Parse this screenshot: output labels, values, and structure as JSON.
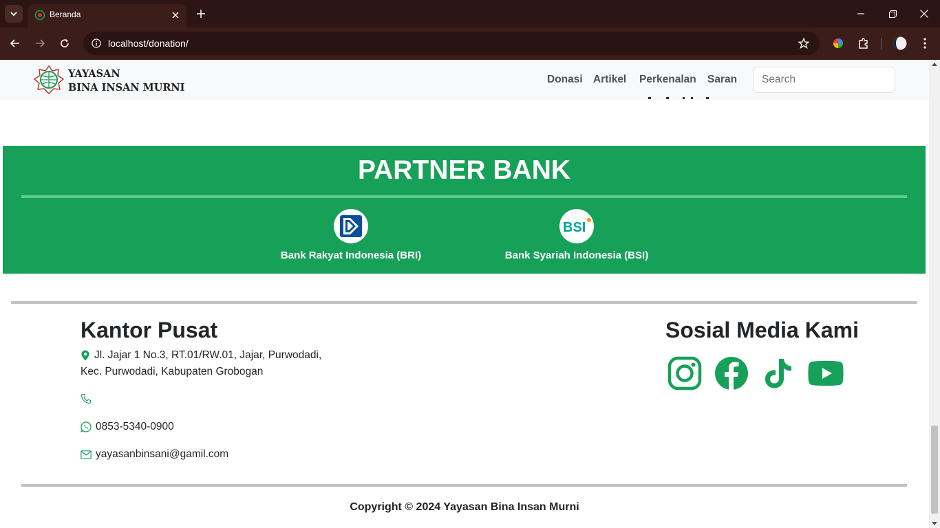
{
  "browser": {
    "tab_title": "Beranda",
    "url": "localhost/donation/"
  },
  "navbar": {
    "brand_line1": "YAYASAN",
    "brand_line2": "BINA INSAN MURNI",
    "links": [
      "Donasi",
      "Artikel",
      "Perkenalan",
      "Saran"
    ],
    "search_placeholder": "Search"
  },
  "partner_bank": {
    "title": "PARTNER BANK",
    "banks": [
      {
        "name": "Bank Rakyat Indonesia (BRI)",
        "logo": "bri-logo"
      },
      {
        "name": "Bank Syariah Indonesia (BSI)",
        "logo": "bsi-logo",
        "logo_text": "BSI"
      }
    ]
  },
  "footer": {
    "office_title": "Kantor Pusat",
    "address_line1": "Jl. Jajar 1 No.3, RT.01/RW.01, Jajar, Purwodadi,",
    "address_line2": "Kec. Purwodadi, Kabupaten Grobogan",
    "phone": "",
    "whatsapp": "0853-5340-0900",
    "email": "yayasanbinsani@gamil.com",
    "social_title": "Sosial Media Kami",
    "social_icons": [
      "instagram-icon",
      "facebook-icon",
      "tiktok-icon",
      "youtube-icon"
    ],
    "copyright": "Copyright © 2024 Yayasan Bina Insan Murni"
  },
  "colors": {
    "brand_green": "#17a058",
    "chrome_bg": "#3b1e1a",
    "tabbar_bg": "#2c1512"
  }
}
